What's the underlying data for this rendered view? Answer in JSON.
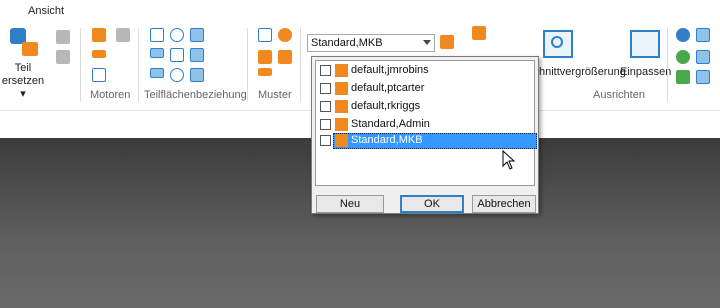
{
  "tabs": {
    "active": "Ansicht"
  },
  "ribbon": {
    "teil_ersetzen": [
      "Teil",
      "ersetzen"
    ],
    "groups": {
      "motoren": "Motoren",
      "teilflaechen": "Teilflächenbeziehung",
      "muster": "Muster",
      "ausrichten": "Ausrichten"
    },
    "ausschnitt_label": "hnittvergrößerung",
    "einpassen_label": "Einpassen",
    "style_combo": {
      "value": "Standard,MKB"
    }
  },
  "dropdown": {
    "items": [
      {
        "label": "default,jmrobins",
        "selected": false
      },
      {
        "label": "default,ptcarter",
        "selected": false
      },
      {
        "label": "default,rkriggs",
        "selected": false
      },
      {
        "label": "Standard,Admin",
        "selected": false
      },
      {
        "label": "Standard,MKB",
        "selected": true
      }
    ],
    "buttons": {
      "new": "Neu",
      "ok": "OK",
      "cancel": "Abbrechen"
    }
  },
  "colors": {
    "highlight": "#3399ff",
    "accent": "#2f7fc9",
    "icon_orange": "#f08a1e"
  }
}
